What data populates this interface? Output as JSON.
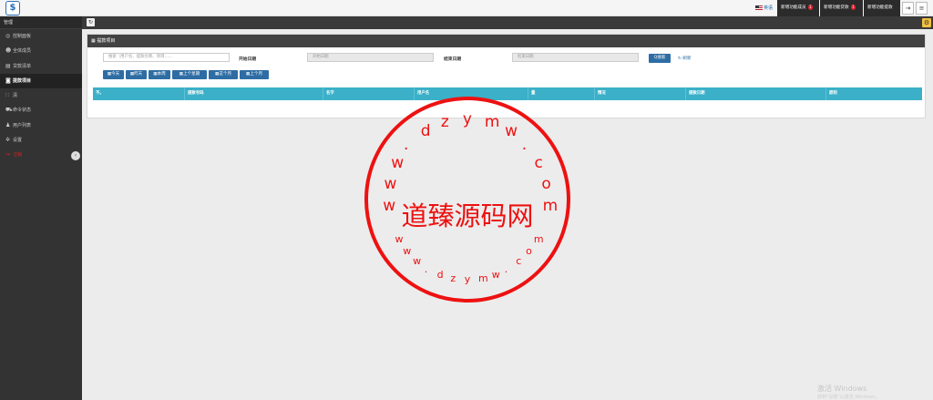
{
  "topbar": {
    "logo_glyph": "$",
    "lang_label": "英语",
    "buttons": [
      {
        "label": "新增功能成员",
        "badge": "1"
      },
      {
        "label": "新增功能贷款",
        "badge": "1"
      },
      {
        "label": "新增功能提款",
        "badge": ""
      }
    ],
    "logout_icon": "⇥",
    "menu_icon": "≡"
  },
  "sidebar": {
    "header": "管理",
    "items": [
      {
        "icon": "dashboard-icon",
        "glyph": "◎",
        "label": "控制面板"
      },
      {
        "icon": "users-icon",
        "glyph": "☻",
        "label": "全体成员"
      },
      {
        "icon": "list-icon",
        "glyph": "▤",
        "label": "贷款清单"
      },
      {
        "icon": "money-icon",
        "glyph": "◙",
        "label": "提款项目"
      },
      {
        "icon": "grid-icon",
        "glyph": "∷",
        "label": "清"
      },
      {
        "icon": "cart-icon",
        "glyph": "⛟",
        "label": "命令状态"
      },
      {
        "icon": "user-icon",
        "glyph": "♟",
        "label": "用户列表"
      },
      {
        "icon": "gear-icon",
        "glyph": "✲",
        "label": "设置"
      },
      {
        "icon": "logout-icon",
        "glyph": "↪",
        "label": "注销"
      }
    ],
    "collapse_glyph": "‹"
  },
  "content": {
    "refresh_glyph": "↻",
    "settings_glyph": "⚙"
  },
  "panel": {
    "title": "提款项目",
    "search_placeholder": "搜索（用户名、提款名称、项目......",
    "start_label": "开始日期",
    "start_placeholder": "开始日期",
    "end_label": "结束日期",
    "end_placeholder": "结束日期",
    "search_button": "Q搜索",
    "reset_link": "↻ 刷新",
    "quick_filters": [
      "今天",
      "昨天",
      "本周",
      "上个星期",
      "这个月",
      "上个月"
    ],
    "columns": [
      "不。",
      "提款号码",
      "名字",
      "用户名",
      "量",
      "情况",
      "提款日期",
      "原则"
    ]
  },
  "stamp": {
    "center": "道臻源码网",
    "ring_top": "www.dzymw.com",
    "ring_bottom": "www.dzymw.com"
  },
  "watermark": {
    "line1": "激活 Windows",
    "line2": "转到\"设置\"以激活 Windows。"
  },
  "colors": {
    "sidebar_bg": "#333333",
    "topbar_btn_bg": "#2b2b2b",
    "primary_btn": "#2e6da4",
    "table_header": "#3bb0c8",
    "badge": "#d9232d",
    "stamp": "#ee1111",
    "settings_btn": "#f0c040"
  }
}
